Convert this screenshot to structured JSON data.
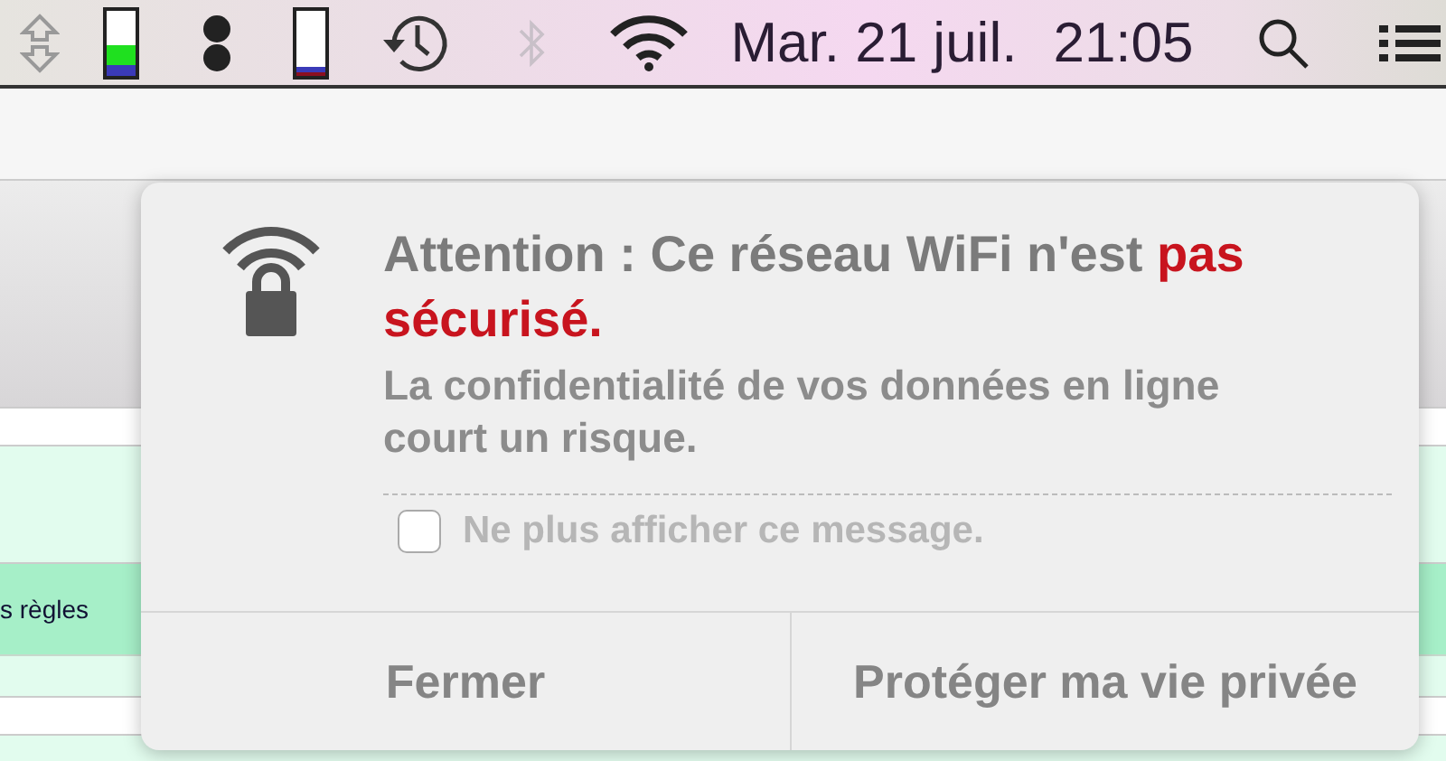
{
  "menu_bar": {
    "bluetooth": {
      "disabled": true
    },
    "date": "Mar. 21 juil.",
    "time": "21:05"
  },
  "background": {
    "rule_label": "s règles"
  },
  "alert": {
    "headline": {
      "text": "Attention : Ce réseau WiFi n'est",
      "warning": "pas sécurisé."
    },
    "message": "La confidentialité de vos données en ligne court un risque.",
    "dont_show": {
      "label": "Ne plus afficher ce message.",
      "checked": false
    },
    "buttons": [
      "Fermer",
      "Protéger ma vie privée"
    ]
  }
}
